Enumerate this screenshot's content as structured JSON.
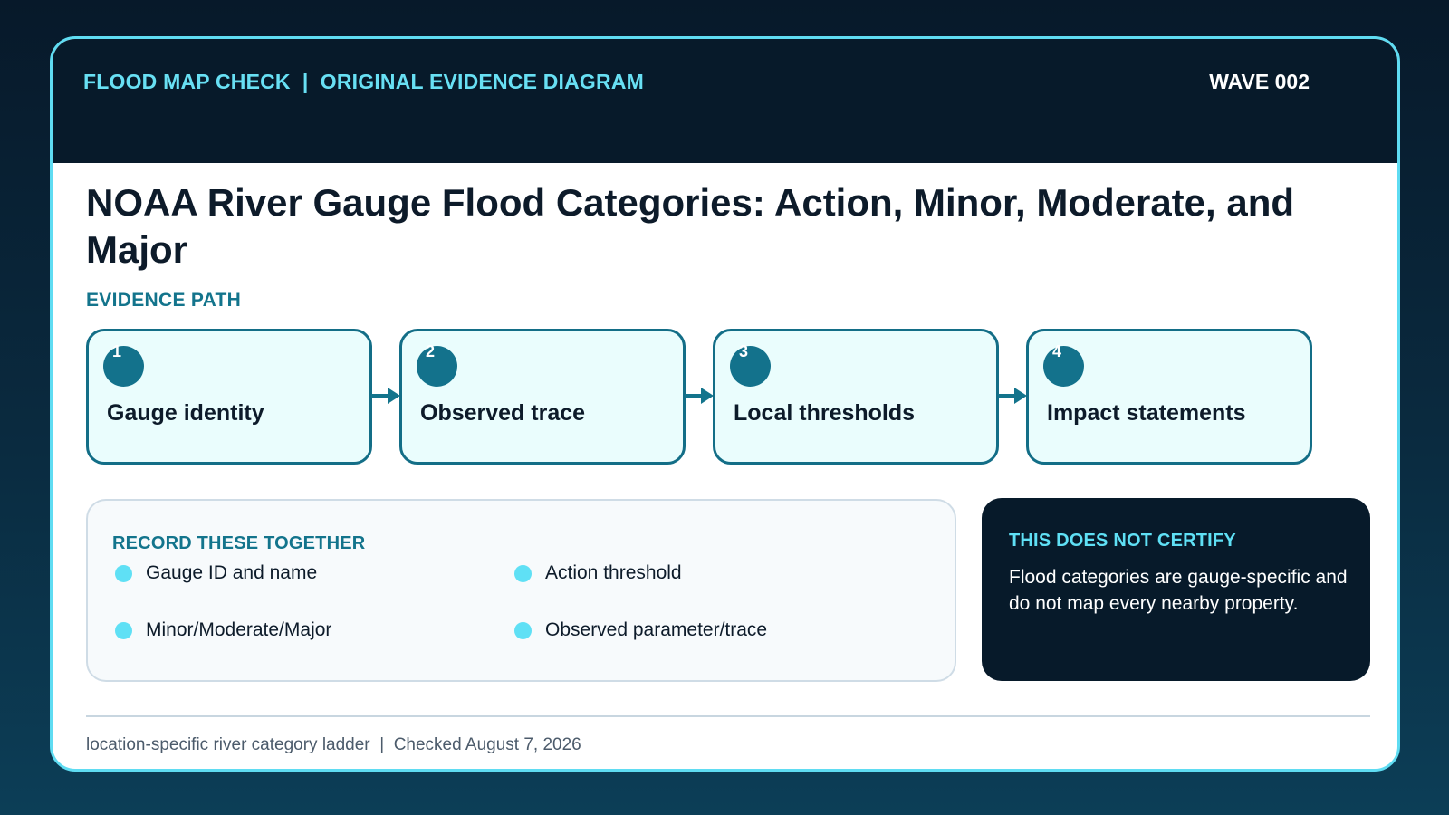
{
  "header": {
    "kicker": "FLOOD MAP CHECK  |  ORIGINAL EVIDENCE DIAGRAM",
    "wave": "WAVE 002"
  },
  "title": "NOAA River Gauge Flood Categories: Action, Minor, Moderate, and Major",
  "evidence_path": {
    "label": "EVIDENCE PATH",
    "steps": [
      {
        "number": "1",
        "label": "Gauge identity"
      },
      {
        "number": "2",
        "label": "Observed trace"
      },
      {
        "number": "3",
        "label": "Local thresholds"
      },
      {
        "number": "4",
        "label": "Impact statements"
      }
    ]
  },
  "record": {
    "label": "RECORD THESE TOGETHER",
    "items": [
      "Gauge ID and name",
      "Action threshold",
      "Minor/Moderate/Major",
      "Observed parameter/trace"
    ]
  },
  "certify": {
    "label": "THIS DOES NOT CERTIFY",
    "body": "Flood categories are gauge-specific and do not map every nearby property."
  },
  "footer": "location-specific river category ladder  |  Checked August 7, 2026",
  "colors": {
    "accent": "#13748c",
    "highlight": "#5fe0f5",
    "dark": "#071a2a",
    "step_fill": "#eafdfd"
  }
}
